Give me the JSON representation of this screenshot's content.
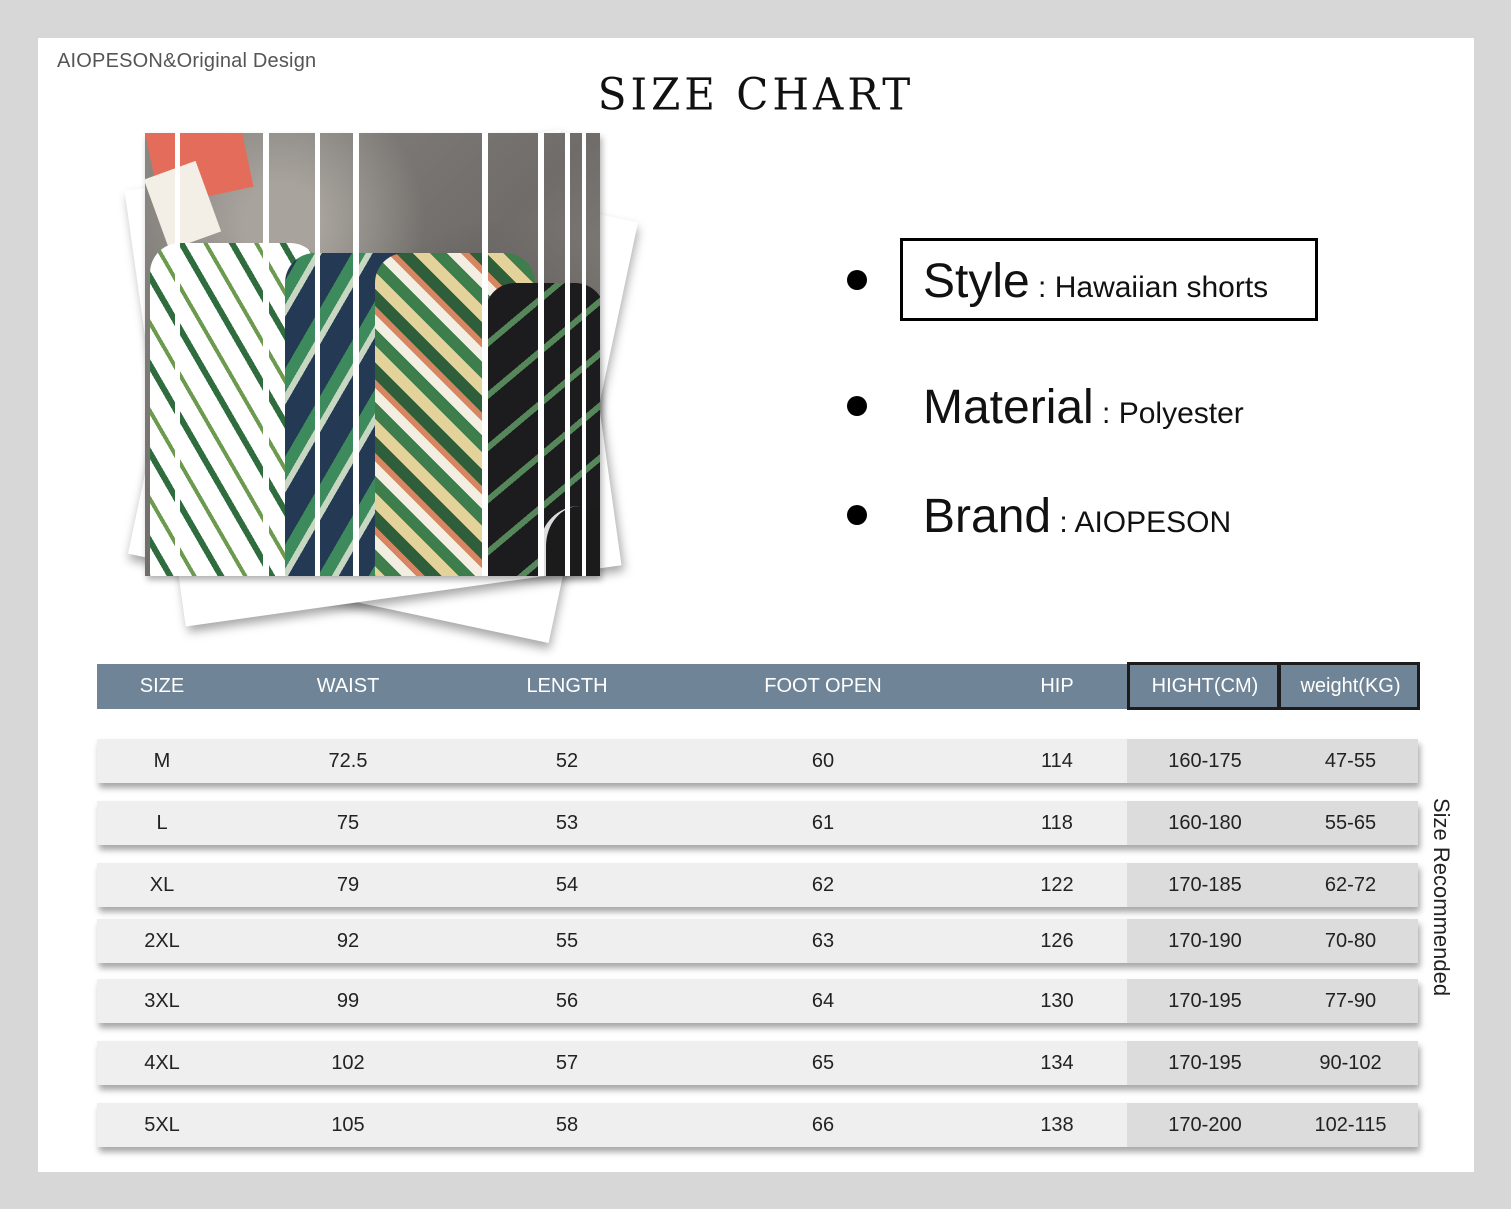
{
  "brand_line": "AIOPESON&Original Design",
  "title": "SIZE CHART",
  "specs": {
    "style": {
      "label": "Style",
      "sep": " : ",
      "value": "Hawaiian shorts"
    },
    "material": {
      "label": "Material",
      "sep": " : ",
      "value": "Polyester"
    },
    "brand": {
      "label": "Brand",
      "sep": " : ",
      "value": "AIOPESON"
    }
  },
  "table": {
    "headers": {
      "size": "SIZE",
      "waist": "WAIST",
      "length": "LENGTH",
      "foot_open": "FOOT OPEN",
      "hip": "HIP",
      "hight": "HIGHT(CM)",
      "weight": "weight(KG)"
    },
    "rows": [
      {
        "size": "M",
        "waist": "72.5",
        "length": "52",
        "foot_open": "60",
        "hip": "114",
        "hight": "160-175",
        "weight": "47-55"
      },
      {
        "size": "L",
        "waist": "75",
        "length": "53",
        "foot_open": "61",
        "hip": "118",
        "hight": "160-180",
        "weight": "55-65"
      },
      {
        "size": "XL",
        "waist": "79",
        "length": "54",
        "foot_open": "62",
        "hip": "122",
        "hight": "170-185",
        "weight": "62-72"
      },
      {
        "size": "2XL",
        "waist": "92",
        "length": "55",
        "foot_open": "63",
        "hip": "126",
        "hight": "170-190",
        "weight": "70-80"
      },
      {
        "size": "3XL",
        "waist": "99",
        "length": "56",
        "foot_open": "64",
        "hip": "130",
        "hight": "170-195",
        "weight": "77-90"
      },
      {
        "size": "4XL",
        "waist": "102",
        "length": "57",
        "foot_open": "65",
        "hip": "134",
        "hight": "170-195",
        "weight": "90-102"
      },
      {
        "size": "5XL",
        "waist": "105",
        "length": "58",
        "foot_open": "66",
        "hip": "138",
        "hight": "170-200",
        "weight": "102-115"
      }
    ]
  },
  "side_note": "Size Recommended",
  "colors": {
    "header_bg": "#6f8497",
    "row_bg": "#efefef",
    "recommend_bg": "#dcdcdc",
    "page_bg": "#d7d7d7"
  }
}
